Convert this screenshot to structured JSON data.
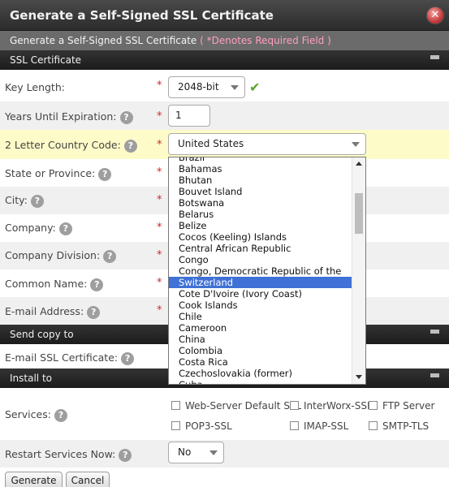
{
  "window": {
    "title": "Generate a Self-Signed SSL Certificate",
    "close_glyph": "✕"
  },
  "subheader": {
    "text": "Generate a Self-Signed SSL Certificate",
    "required_note": "( *Denotes Required Field )"
  },
  "sections": {
    "ssl": "SSL Certificate",
    "send_copy": "Send copy to",
    "install": "Install to"
  },
  "fields": {
    "key_length": {
      "label": "Key Length:",
      "value": "2048-bit"
    },
    "years": {
      "label": "Years Until Expiration:",
      "value": "1"
    },
    "country": {
      "label": "2 Letter Country Code:",
      "value": "United States"
    },
    "state": {
      "label": "State or Province:"
    },
    "city": {
      "label": "City:"
    },
    "company": {
      "label": "Company:"
    },
    "division": {
      "label": "Company Division:"
    },
    "common_name": {
      "label": "Common Name:"
    },
    "email": {
      "label": "E-mail Address:"
    },
    "email_cert": {
      "label": "E-mail SSL Certificate:"
    },
    "services": {
      "label": "Services:"
    },
    "restart": {
      "label": "Restart Services Now:",
      "value": "No"
    }
  },
  "required_star": "*",
  "help_glyph": "?",
  "country_list": {
    "items": [
      "Brazil",
      "Bahamas",
      "Bhutan",
      "Bouvet Island",
      "Botswana",
      "Belarus",
      "Belize",
      "Cocos (Keeling) Islands",
      "Central African Republic",
      "Congo",
      "Congo, Democratic Republic of the",
      "Switzerland",
      "Cote D'Ivoire (Ivory Coast)",
      "Cook Islands",
      "Chile",
      "Cameroon",
      "China",
      "Colombia",
      "Costa Rica",
      "Czechoslovakia (former)",
      "Cuba"
    ],
    "selected": "Switzerland"
  },
  "services": {
    "web_server": "Web-Server Default SSL",
    "interworx": "InterWorx-SSL",
    "ftp": "FTP Server",
    "pop3": "POP3-SSL",
    "imap": "IMAP-SSL",
    "smtp": "SMTP-TLS"
  },
  "buttons": {
    "generate": "Generate",
    "cancel": "Cancel"
  },
  "colors": {
    "selected_item": "#3f71d6",
    "required": "#d0262c",
    "valid_check": "#5aa12a",
    "note": "#ff9fc0"
  }
}
